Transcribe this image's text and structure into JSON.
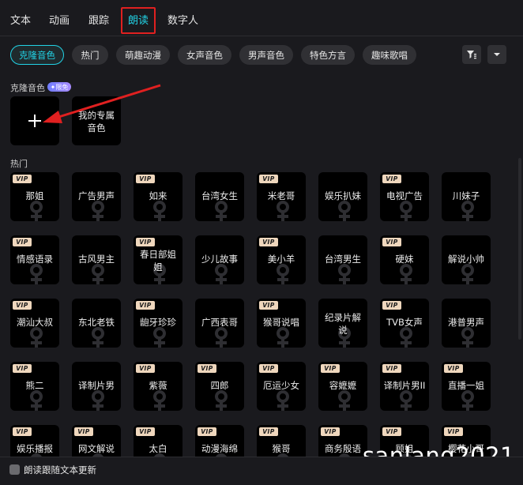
{
  "tabs": [
    {
      "label": "文本"
    },
    {
      "label": "动画"
    },
    {
      "label": "跟踪"
    },
    {
      "label": "朗读",
      "active": true
    },
    {
      "label": "数字人"
    }
  ],
  "filters": [
    "克隆音色",
    "热门",
    "萌趣动漫",
    "女声音色",
    "男声音色",
    "特色方言",
    "趣味歌唱"
  ],
  "active_filter": "克隆音色",
  "filter_icon": "filter-icon",
  "dropdown_icon": "chevron-down-icon",
  "clone": {
    "section_label": "克隆音色",
    "badge": "✦限免",
    "add_icon": "plus-icon",
    "my_voice_label": "我的专属音色"
  },
  "hot": {
    "section_label": "热门",
    "vip_label": "VIP",
    "voices": [
      {
        "name": "那姐",
        "vip": true
      },
      {
        "name": "广告男声",
        "vip": false
      },
      {
        "name": "如来",
        "vip": true
      },
      {
        "name": "台湾女生",
        "vip": false
      },
      {
        "name": "米老哥",
        "vip": true
      },
      {
        "name": "娱乐扒妹",
        "vip": false
      },
      {
        "name": "电视广告",
        "vip": true
      },
      {
        "name": "川妹子",
        "vip": false
      },
      {
        "name": "情感语录",
        "vip": true
      },
      {
        "name": "古风男主",
        "vip": false
      },
      {
        "name": "春日部姐姐",
        "vip": true
      },
      {
        "name": "少儿故事",
        "vip": false
      },
      {
        "name": "美小羊",
        "vip": true
      },
      {
        "name": "台湾男生",
        "vip": false
      },
      {
        "name": "硬妹",
        "vip": true
      },
      {
        "name": "解说小帅",
        "vip": false
      },
      {
        "name": "潮汕大叔",
        "vip": true
      },
      {
        "name": "东北老铁",
        "vip": false
      },
      {
        "name": "龅牙珍珍",
        "vip": true
      },
      {
        "name": "广西表哥",
        "vip": false
      },
      {
        "name": "猴哥说唱",
        "vip": true
      },
      {
        "name": "纪录片解说",
        "vip": false
      },
      {
        "name": "TVB女声",
        "vip": true
      },
      {
        "name": "港普男声",
        "vip": false
      },
      {
        "name": "熊二",
        "vip": true
      },
      {
        "name": "译制片男",
        "vip": false
      },
      {
        "name": "紫薇",
        "vip": true
      },
      {
        "name": "四郎",
        "vip": true
      },
      {
        "name": "厄运少女",
        "vip": true
      },
      {
        "name": "容嬷嬷",
        "vip": true
      },
      {
        "name": "译制片男II",
        "vip": true
      },
      {
        "name": "直播一姐",
        "vip": true
      },
      {
        "name": "娱乐播报",
        "vip": true
      },
      {
        "name": "网文解说",
        "vip": true
      },
      {
        "name": "太白",
        "vip": true
      },
      {
        "name": "动漫海绵",
        "vip": true
      },
      {
        "name": "猴哥",
        "vip": true
      },
      {
        "name": "商务殷语",
        "vip": true
      },
      {
        "name": "顾姐",
        "vip": true
      },
      {
        "name": "樱花小哥",
        "vip": true
      }
    ]
  },
  "footer": {
    "checkbox_label": "朗读跟随文本更新"
  },
  "watermark": "sanlang2021",
  "colors": {
    "accent": "#22d3e6",
    "highlight_box": "#e02020",
    "arrow": "#e02020",
    "vip_badge": "#efd7bd"
  }
}
